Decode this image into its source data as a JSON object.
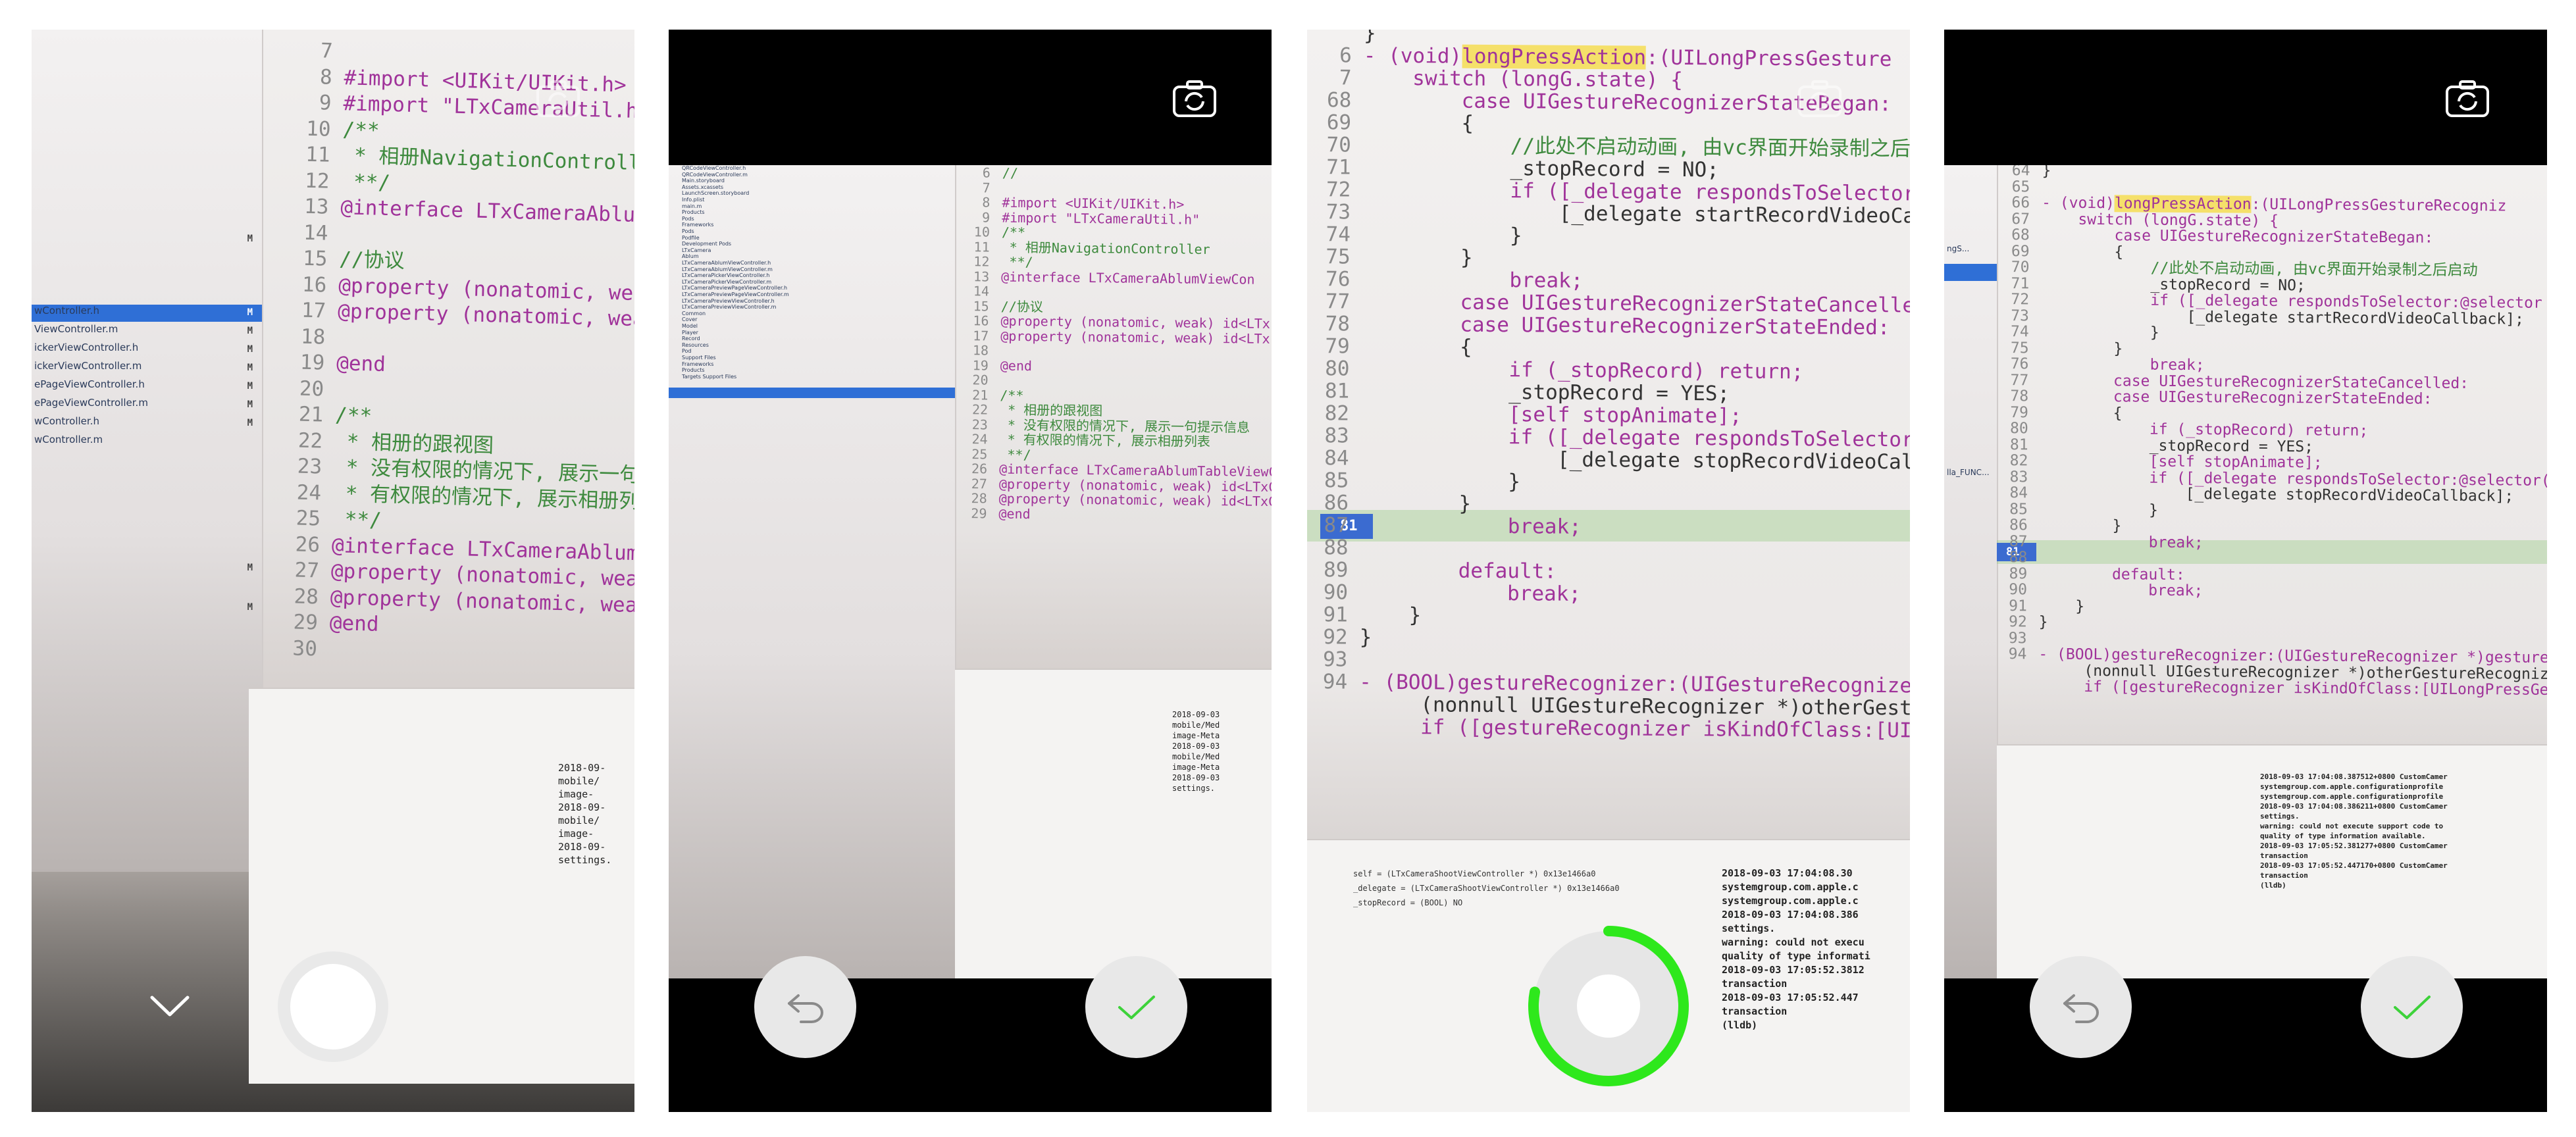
{
  "screens": [
    {
      "id": "record-idle",
      "controls": {
        "dismiss_icon": "chevron-down-icon",
        "record_button": "record-button",
        "switch_camera_icon": "camera-switch-icon"
      },
      "code_lines": [
        {
          "n": "7",
          "text": ""
        },
        {
          "n": "8",
          "text": "#import <UIKit/UIKit.h>"
        },
        {
          "n": "9",
          "text": "#import \"LTxCameraUtil.h\""
        },
        {
          "n": "10",
          "text": "/**"
        },
        {
          "n": "11",
          "text": " * 相册NavigationController"
        },
        {
          "n": "12",
          "text": " **/"
        },
        {
          "n": "13",
          "text": "@interface LTxCameraAblumView"
        },
        {
          "n": "14",
          "text": ""
        },
        {
          "n": "15",
          "text": "//协议"
        },
        {
          "n": "16",
          "text": "@property (nonatomic, weak) id"
        },
        {
          "n": "17",
          "text": "@property (nonatomic, weak) id"
        },
        {
          "n": "18",
          "text": ""
        },
        {
          "n": "19",
          "text": "@end"
        },
        {
          "n": "20",
          "text": ""
        },
        {
          "n": "21",
          "text": "/**"
        },
        {
          "n": "22",
          "text": " * 相册的跟视图"
        },
        {
          "n": "23",
          "text": " * 没有权限的情况下, 展示一句提示信息"
        },
        {
          "n": "24",
          "text": " * 有权限的情况下, 展示相册列表"
        },
        {
          "n": "25",
          "text": " **/"
        },
        {
          "n": "26",
          "text": "@interface LTxCameraAblumTableView"
        },
        {
          "n": "27",
          "text": "@property (nonatomic, weak) id<LTxC"
        },
        {
          "n": "28",
          "text": "@property (nonatomic, weak) id<LTxC"
        },
        {
          "n": "29",
          "text": "@end"
        },
        {
          "n": "30",
          "text": ""
        }
      ],
      "sidebar_files": [
        "wController.h",
        "ViewController.m",
        "ickerViewController.h",
        "ickerViewController.m",
        "ePageViewController.h",
        "ePageViewController.m",
        "wController.h",
        "wController.m"
      ],
      "console_lines": [
        "2018-09-",
        "mobile/",
        "image-",
        "2018-09-",
        "mobile/",
        "image-",
        "2018-09-",
        "settings."
      ]
    },
    {
      "id": "photo-review",
      "controls": {
        "back_icon": "undo-arrow-icon",
        "confirm_icon": "checkmark-icon",
        "switch_camera_icon": "camera-switch-icon"
      },
      "code_lines": [
        {
          "n": "6",
          "text": "//"
        },
        {
          "n": "7",
          "text": ""
        },
        {
          "n": "8",
          "text": "#import <UIKit/UIKit.h>"
        },
        {
          "n": "9",
          "text": "#import \"LTxCameraUtil.h\""
        },
        {
          "n": "10",
          "text": "/**"
        },
        {
          "n": "11",
          "text": " * 相册NavigationController"
        },
        {
          "n": "12",
          "text": " **/"
        },
        {
          "n": "13",
          "text": "@interface LTxCameraAblumViewCon"
        },
        {
          "n": "14",
          "text": ""
        },
        {
          "n": "15",
          "text": "//协议"
        },
        {
          "n": "16",
          "text": "@property (nonatomic, weak) id<LTx"
        },
        {
          "n": "17",
          "text": "@property (nonatomic, weak) id<LTx"
        },
        {
          "n": "18",
          "text": ""
        },
        {
          "n": "19",
          "text": "@end"
        },
        {
          "n": "20",
          "text": ""
        },
        {
          "n": "21",
          "text": "/**"
        },
        {
          "n": "22",
          "text": " * 相册的跟视图"
        },
        {
          "n": "23",
          "text": " * 没有权限的情况下, 展示一句提示信息"
        },
        {
          "n": "24",
          "text": " * 有权限的情况下, 展示相册列表"
        },
        {
          "n": "25",
          "text": " **/"
        },
        {
          "n": "26",
          "text": "@interface LTxCameraAblumTableViewCont"
        },
        {
          "n": "27",
          "text": "@property (nonatomic, weak) id<LTxCame"
        },
        {
          "n": "28",
          "text": "@property (nonatomic, weak) id<LTxCame"
        },
        {
          "n": "29",
          "text": "@end"
        }
      ],
      "sidebar_files": [
        "QRCodeViewController.h",
        "QRCodeViewController.m",
        "Main.storyboard",
        "Assets.xcassets",
        "LaunchScreen.storyboard",
        "Info.plist",
        "main.m",
        "Products",
        "Pods",
        "Frameworks",
        "Pods",
        "Podfile",
        "Development Pods",
        "LTxCamera",
        "Ablum",
        "LTxCameraAblumViewController.h",
        "LTxCameraAblumViewController.m",
        "LTxCameraPickerViewController.h",
        "LTxCameraPickerViewController.m",
        "LTxCameraPreviewPageViewController.h",
        "LTxCameraPreviewPageViewController.m",
        "LTxCameraPreviewViewController.h",
        "LTxCameraPreviewViewController.m",
        "Common",
        "Cover",
        "Model",
        "Player",
        "Record",
        "Resources",
        "Pod",
        "Support Files",
        "Frameworks",
        "Products",
        "Targets Support Files"
      ],
      "console_lines": [
        "2018-09-03",
        "mobile/Med",
        "image-Meta",
        "2018-09-03",
        "mobile/Med",
        "image-Meta",
        "2018-09-03",
        "settings."
      ]
    },
    {
      "id": "recording",
      "progress": 0.78,
      "controls": {
        "record_button": "record-button-progress",
        "switch_camera_icon": "camera-switch-icon"
      },
      "code_lines": [
        {
          "n": "",
          "text": "}"
        },
        {
          "n": "6",
          "text": "- (void)longPressAction:(UILongPressGesture"
        },
        {
          "n": "7",
          "text": "    switch (longG.state) {"
        },
        {
          "n": "68",
          "text": "        case UIGestureRecognizerStateBegan:"
        },
        {
          "n": "69",
          "text": "        {"
        },
        {
          "n": "70",
          "text": "            //此处不启动动画, 由vc界面开始录制之后启"
        },
        {
          "n": "71",
          "text": "            _stopRecord = NO;"
        },
        {
          "n": "72",
          "text": "            if ([_delegate respondsToSelector"
        },
        {
          "n": "73",
          "text": "                [_delegate startRecordVideoCa"
        },
        {
          "n": "74",
          "text": "            }"
        },
        {
          "n": "75",
          "text": "        }"
        },
        {
          "n": "76",
          "text": "            break;"
        },
        {
          "n": "77",
          "text": "        case UIGestureRecognizerStateCancelled"
        },
        {
          "n": "78",
          "text": "        case UIGestureRecognizerStateEnded:"
        },
        {
          "n": "79",
          "text": "        {"
        },
        {
          "n": "80",
          "text": "            if (_stopRecord) return;"
        },
        {
          "n": "81",
          "text": "            _stopRecord = YES;"
        },
        {
          "n": "82",
          "text": "            [self stopAnimate];"
        },
        {
          "n": "83",
          "text": "            if ([_delegate respondsToSelector:@s"
        },
        {
          "n": "84",
          "text": "                [_delegate stopRecordVideoCallba"
        },
        {
          "n": "85",
          "text": "            }"
        },
        {
          "n": "86",
          "text": "        }"
        },
        {
          "n": "87",
          "text": "            break;"
        },
        {
          "n": "88",
          "text": ""
        },
        {
          "n": "89",
          "text": "        default:"
        },
        {
          "n": "90",
          "text": "            break;"
        },
        {
          "n": "91",
          "text": "    }"
        },
        {
          "n": "92",
          "text": "}"
        },
        {
          "n": "93",
          "text": ""
        },
        {
          "n": "94",
          "text": "- (BOOL)gestureRecognizer:(UIGestureRecognizer *)g"
        },
        {
          "n": "",
          "text": "     (nonnull UIGestureRecognizer *)otherGestureReco"
        },
        {
          "n": "",
          "text": "     if ([gestureRecognizer isKindOfClass:[UILongPr"
        }
      ],
      "console_lines": [
        "2018-09-03 17:04:08.30",
        "systemgroup.com.apple.c",
        "systemgroup.com.apple.c",
        "2018-09-03 17:04:08.386",
        "settings.",
        "warning: could not execu",
        "quality of type informati",
        "2018-09-03 17:05:52.3812",
        "transaction",
        "2018-09-03 17:05:52.447",
        "transaction",
        "(lldb)"
      ],
      "debug_vars": [
        "self = (LTxCameraShootViewController *) 0x13e1466a0",
        "_delegate = (LTxCameraShootViewController *) 0x13e1466a0",
        "_stopRecord = (BOOL) NO"
      ]
    },
    {
      "id": "video-review",
      "controls": {
        "back_icon": "undo-arrow-icon",
        "confirm_icon": "checkmark-icon",
        "switch_camera_icon": "camera-switch-icon"
      },
      "code_lines": [
        {
          "n": "64",
          "text": "}"
        },
        {
          "n": "65",
          "text": ""
        },
        {
          "n": "66",
          "text": "- (void)longPressAction:(UILongPressGestureRecogniz"
        },
        {
          "n": "67",
          "text": "    switch (longG.state) {"
        },
        {
          "n": "68",
          "text": "        case UIGestureRecognizerStateBegan:"
        },
        {
          "n": "69",
          "text": "        {"
        },
        {
          "n": "70",
          "text": "            //此处不启动动画, 由vc界面开始录制之后启动"
        },
        {
          "n": "71",
          "text": "            _stopRecord = NO;"
        },
        {
          "n": "72",
          "text": "            if ([_delegate respondsToSelector:@selector"
        },
        {
          "n": "73",
          "text": "                [_delegate startRecordVideoCallback];"
        },
        {
          "n": "74",
          "text": "            }"
        },
        {
          "n": "75",
          "text": "        }"
        },
        {
          "n": "76",
          "text": "            break;"
        },
        {
          "n": "77",
          "text": "        case UIGestureRecognizerStateCancelled:"
        },
        {
          "n": "78",
          "text": "        case UIGestureRecognizerStateEnded:"
        },
        {
          "n": "79",
          "text": "        {"
        },
        {
          "n": "80",
          "text": "            if (_stopRecord) return;"
        },
        {
          "n": "81",
          "text": "            _stopRecord = YES;"
        },
        {
          "n": "82",
          "text": "            [self stopAnimate];"
        },
        {
          "n": "83",
          "text": "            if ([_delegate respondsToSelector:@selector(sto"
        },
        {
          "n": "84",
          "text": "                [_delegate stopRecordVideoCallback];"
        },
        {
          "n": "85",
          "text": "            }"
        },
        {
          "n": "86",
          "text": "        }"
        },
        {
          "n": "87",
          "text": "            break;"
        },
        {
          "n": "88",
          "text": ""
        },
        {
          "n": "89",
          "text": "        default:"
        },
        {
          "n": "90",
          "text": "            break;"
        },
        {
          "n": "91",
          "text": "    }"
        },
        {
          "n": "92",
          "text": "}"
        },
        {
          "n": "93",
          "text": ""
        },
        {
          "n": "94",
          "text": "- (BOOL)gestureRecognizer:(UIGestureRecognizer *)gestureRecognizer"
        },
        {
          "n": "",
          "text": "     (nonnull UIGestureRecognizer *)otherGestureRecognizer{"
        },
        {
          "n": "",
          "text": "     if ([gestureRecognizer isKindOfClass:[UILongPressGestureRecog"
        }
      ],
      "sidebar_files": [
        "ngS...",
        "lla_FUNC..."
      ],
      "console_lines": [
        "2018-09-03 17:04:08.387512+0800 CustomCamer",
        "systemgroup.com.apple.configurationprofile",
        "systemgroup.com.apple.configurationprofile",
        "2018-09-03 17:04:08.386211+0800 CustomCamer",
        "settings.",
        "warning: could not execute support code to",
        "quality of type information available.",
        "2018-09-03 17:05:52.381277+0800 CustomCamer",
        "transaction",
        "2018-09-03 17:05:52.447170+0800 CustomCamer",
        "transaction",
        "(lldb)"
      ]
    }
  ],
  "colors": {
    "progress_ring": "#2ee81c",
    "checkmark": "#3dd23a",
    "control_bg": "#e8e8e8",
    "selection": "#2f6fd6",
    "highlight": "#f5e06a"
  }
}
